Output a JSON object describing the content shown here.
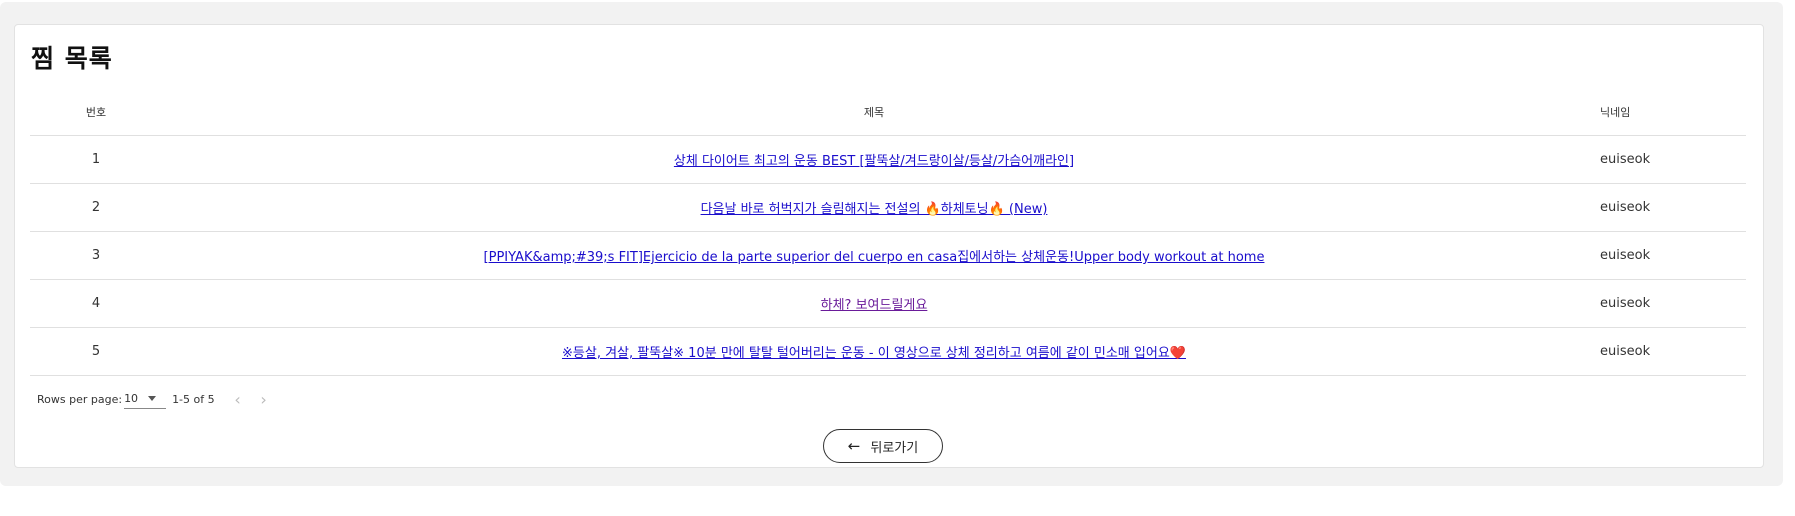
{
  "page": {
    "title": "찜 목록"
  },
  "table": {
    "headers": {
      "num": "번호",
      "title": "제목",
      "nickname": "닉네임"
    },
    "rows": [
      {
        "num": "1",
        "title": "상체 다이어트 최고의 운동 BEST [팔뚝살/겨드랑이살/등살/가슴어깨라인]",
        "nickname": "euiseok"
      },
      {
        "num": "2",
        "title": "다음날 바로 허벅지가 슬림해지는 전설의 🔥하체토닝🔥 (New)",
        "nickname": "euiseok"
      },
      {
        "num": "3",
        "title": "[PPIYAK&amp;#39;s FIT]Ejercicio de la parte superior del cuerpo en casa집에서하는 상체운동!Upper body workout at home",
        "nickname": "euiseok"
      },
      {
        "num": "4",
        "title": "하체? 보여드릴게요",
        "nickname": "euiseok"
      },
      {
        "num": "5",
        "title": "※등살, 겨살, 팔뚝살※ 10분 만에 탈탈 털어버리는 운동 - 이 영상으로 상체 정리하고 여름에 같이 민소매 입어요❤️",
        "nickname": "euiseok"
      }
    ]
  },
  "pagination": {
    "rows_per_page_label": "Rows per page:",
    "rows_per_page_value": "10",
    "range_text": "1-5 of 5",
    "prev_icon": "chevron-left-icon",
    "next_icon": "chevron-right-icon"
  },
  "back_button": {
    "label": "뒤로가기",
    "icon": "arrow-left-icon"
  },
  "colors": {
    "link": "#1a0dcc",
    "visited_link": "#6a1b9a",
    "background": "#f2f2f2",
    "card": "#ffffff",
    "border": "#e0e0e0"
  }
}
